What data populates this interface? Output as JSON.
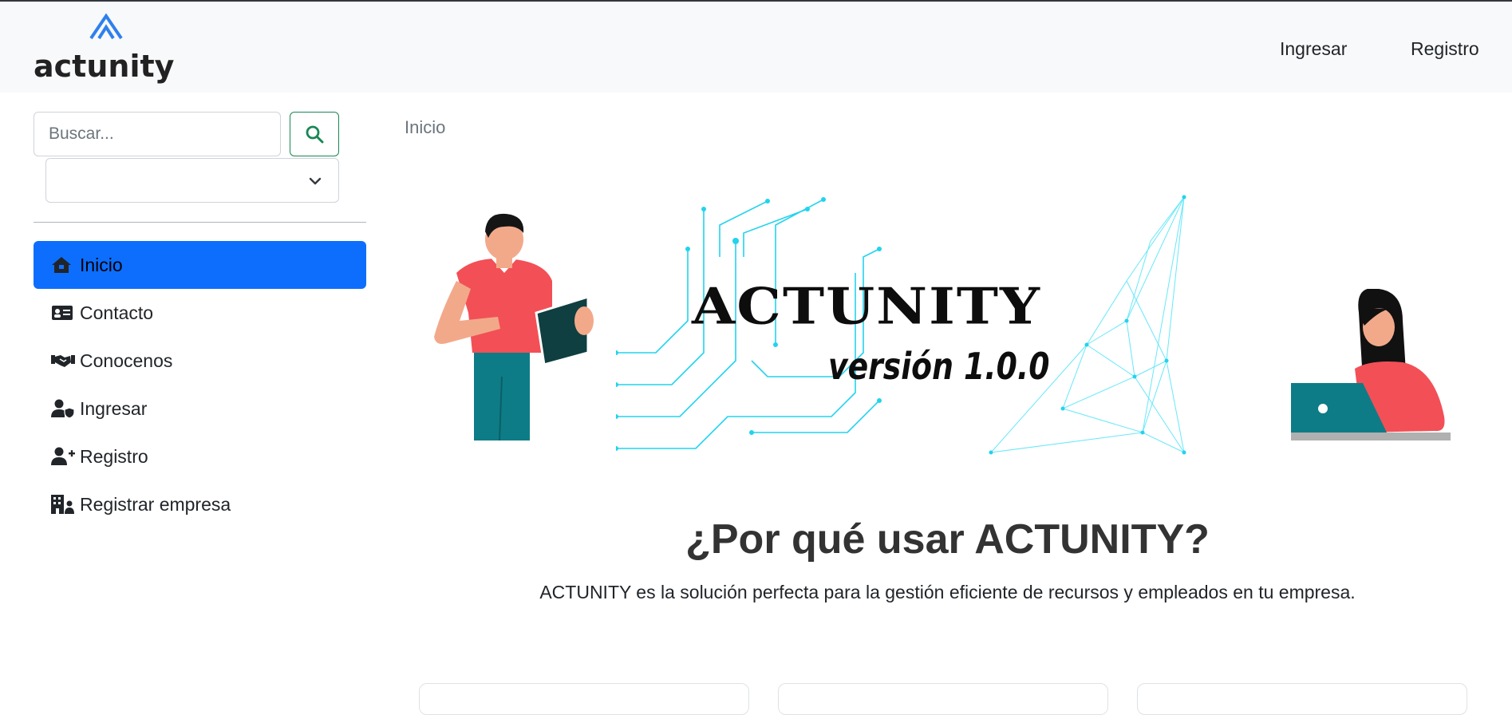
{
  "navbar": {
    "brand": "actunity",
    "links": [
      {
        "label": "Ingresar"
      },
      {
        "label": "Registro"
      }
    ]
  },
  "sidebar": {
    "search": {
      "placeholder": "Buscar...",
      "value": "",
      "button_icon": "search-icon"
    },
    "select": {
      "selected": ""
    },
    "items": [
      {
        "label": "Inicio",
        "icon": "home-icon",
        "active": true
      },
      {
        "label": "Contacto",
        "icon": "contact-card-icon",
        "active": false
      },
      {
        "label": "Conocenos",
        "icon": "handshake-icon",
        "active": false
      },
      {
        "label": "Ingresar",
        "icon": "user-shield-icon",
        "active": false
      },
      {
        "label": "Registro",
        "icon": "user-plus-icon",
        "active": false
      },
      {
        "label": "Registrar empresa",
        "icon": "building-user-icon",
        "active": false
      }
    ]
  },
  "main": {
    "breadcrumb": "Inicio",
    "hero": {
      "title": "ACTUNITY",
      "version": "versión 1.0.0"
    },
    "why": {
      "title": "¿Por qué usar ACTUNITY?",
      "description": "ACTUNITY es la solución perfecta para la gestión eficiente de recursos y empleados en tu empresa."
    }
  },
  "colors": {
    "accent": "#0d6efd",
    "search_button_border": "#198754",
    "navbar_bg": "#f8f9fa",
    "logo_blue": "#2f80ed",
    "circuit_cyan": "#22d3ee"
  }
}
